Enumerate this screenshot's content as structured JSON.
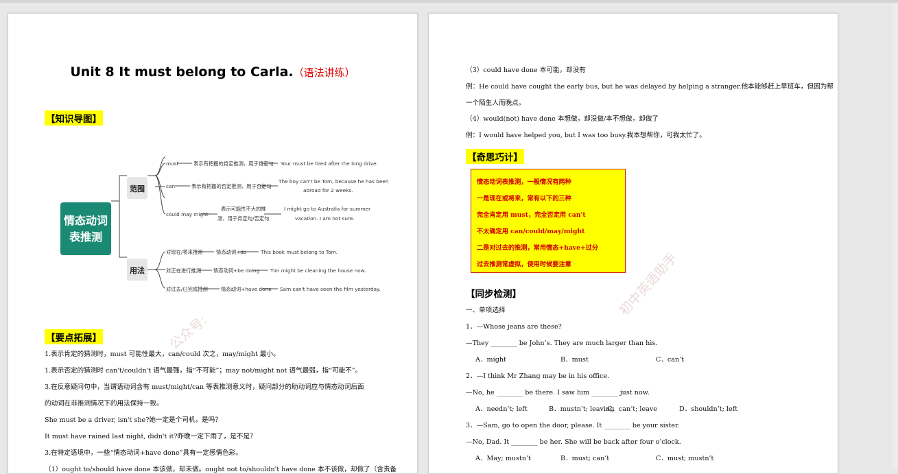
{
  "page1": {
    "title": "Unit 8 It must belong to Carla.",
    "title_suffix": "（语法讲练）",
    "section_map": "【知识导图】",
    "mindmap": {
      "center": [
        "情态动词",
        "表推测"
      ],
      "branch1": "范围",
      "branch2": "用法",
      "r1_label": "must",
      "r1_mid": "表示有把握的肯定推测，用于肯定句",
      "r1_ex": "Your must be tired after the long drive.",
      "r2_label": "can",
      "r2_mid": "表示有把握的否定推测，用于否定句",
      "r2_ex1": "The boy can't be Tom, because he has been",
      "r2_ex2": "abroad for 2 weeks.",
      "r3_label": "could may might",
      "r3_mid1": "表示可能性不大的推",
      "r3_mid2": "测，用于肯定句/否定句",
      "r3_ex1": "I might go to Australia for summer",
      "r3_ex2": "vacation. I am not sure.",
      "u1_label": "对现在/将来推测",
      "u1_mid": "情态动词+do",
      "u1_ex": "This book must belong to Tom.",
      "u2_label": "对正在进行推测",
      "u2_mid": "情态动词+be doing",
      "u2_ex": "Tim might be cleaning the house now.",
      "u3_label": "对过去/已完成推测",
      "u3_mid": "情态动词+have done",
      "u3_ex": "Sam can't have seen the film yesterday."
    },
    "section_points": "【要点拓展】",
    "lines": [
      "1.表示肯定的猜测时，must 可能性最大，can/could 次之，may/might 最小。",
      "1.表示否定的猜测时 can't/couldn't 语气最强，指“不可能”；may not/might not 语气最弱，指“可能不”。",
      "3.在反意疑问句中，当谓语动词含有 must/might/can 等表推测意义时，疑问部分的助动词应与情态动词后面",
      "的动词在非推测情况下的用法保持一致。",
      "She must be a driver, isn't she?她一定是个司机，是吗？",
      "It must have rained last night, didn't it?昨晚一定下雨了，是不是？",
      "3.在特定语境中，一些“情态动词+have done”具有一定感情色彩。",
      "（1）ought to/should have done 本该做，却未做。ought not to/shouldn't have done 本不该做，却做了（含责备"
    ],
    "watermark": "公众号:"
  },
  "page2": {
    "lines": [
      "（3）could have done 本可能，却没有",
      "例：He could have cought the early bus, but he was delayed by helping a stranger.他本能够赶上早班车，但因为帮",
      "一个陌生人而晚点。",
      "（4）would(not) have done 本想做，却没做/本不想做，却做了",
      "例：I would have helped you, but I was too busy.我本想帮你，可我太忙了。"
    ],
    "section_tips": "【奇思巧计】",
    "tips": [
      "情态动词表推测，一般情况有两种",
      "一是现在或将来，常有以下的三种",
      "完全肯定用 must，完全否定用 can't",
      "不太确定用 can/could/may/might",
      "二是对过去的推测，常用情态+have+过分",
      "过去推测常虚拟，使用时候要注意"
    ],
    "section_test": "【同步检测】",
    "part1": "一、单项选择",
    "q1_stem": "1．—Whose jeans are these?",
    "q1_line": "—They ________ be John’s. They are much larger than his.",
    "q1_opts": [
      "A．might",
      "B．must",
      "C．can’t"
    ],
    "q2_stem": "2．—I think Mr Zhang may be in his office.",
    "q2_line": "—No, he ________ be there. I saw him ________ just now.",
    "q2_opts": [
      "A．needn’t; left",
      "B．mustn’t; leaving",
      "C．can’t; leave",
      "D．shouldn’t; left"
    ],
    "q3_stem": "3．—Sam, go to open the door, please. It ________ be your sister.",
    "q3_line": "—No, Dad. It ________ be her. She will be back after four o’clock.",
    "q3_opts": [
      "A．May; mustn’t",
      "B．must; can’t",
      "C．must; mustn’t"
    ],
    "watermark": "初中英语助手"
  },
  "colors": {
    "mindmap_green": "#1a8a74",
    "highlight": "#ffff00",
    "tip_red": "#d20000"
  }
}
